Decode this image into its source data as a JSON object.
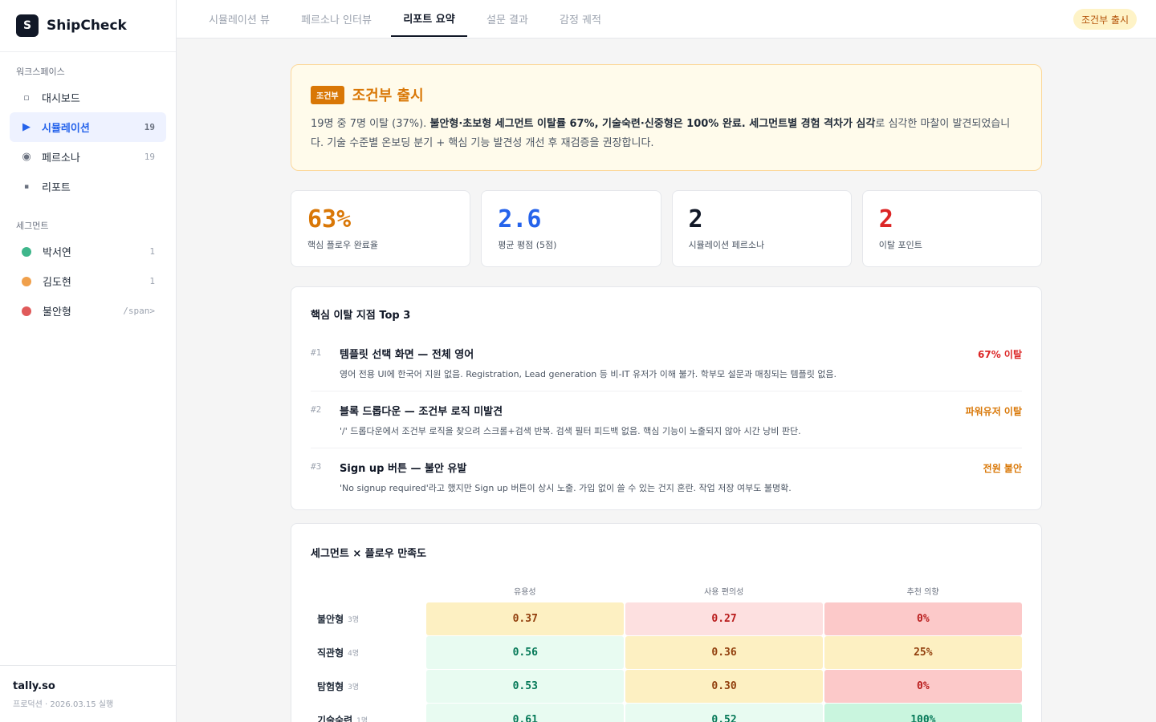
{
  "app": {
    "logo_letter": "S",
    "name": "ShipCheck"
  },
  "sidebar": {
    "workspace_label": "워크스페이스",
    "items": [
      {
        "label": "대시보드",
        "count": "",
        "icon": "square-icon"
      },
      {
        "label": "시뮬레이션",
        "count": "19",
        "icon": "play-icon"
      },
      {
        "label": "페르소나",
        "count": "19",
        "icon": "record-icon"
      },
      {
        "label": "리포트",
        "count": "",
        "icon": "small-square-icon"
      }
    ],
    "segment_label": "세그먼트",
    "segments": [
      {
        "label": "박서연",
        "count": "1",
        "color": "#3fb68b"
      },
      {
        "label": "김도현",
        "count": "1",
        "color": "#f0a04b"
      },
      {
        "label": "불안형",
        "count": "/span>",
        "color": "#e05a5a"
      }
    ],
    "footer": {
      "title": "tally.so",
      "sub": "프로덕션 · 2026.03.15 실행"
    }
  },
  "tabs": [
    "시뮬레이션 뷰",
    "페르소나 인터뷰",
    "리포트 요약",
    "설문 결과",
    "감정 궤적"
  ],
  "top_badge": "조건부 출시",
  "banner": {
    "chip": "조건부",
    "title": "조건부 출시",
    "text_pre": "19명 중 7명 이탈 (37%). ",
    "text_bold": "불안형·초보형 세그먼트 이탈률 67%, 기술숙련·신중형은 100% 완료. 세그먼트별 경험 격차가 심각",
    "text_post": "로 심각한 마찰이 발견되었습니다. 기술 수준별 온보딩 분기 + 핵심 기능 발견성 개선 후 재검증을 권장합니다."
  },
  "stats": [
    {
      "value": "63%",
      "label": "핵심 플로우 완료율",
      "color": "#d97706"
    },
    {
      "value": "2.6",
      "label": "평균 평점 (5점)",
      "color": "#2563eb"
    },
    {
      "value": "2",
      "label": "시뮬레이션 페르소나",
      "color": "#111827"
    },
    {
      "value": "2",
      "label": "이탈 포인트",
      "color": "#dc2626"
    }
  ],
  "drops": {
    "title": "핵심 이탈 지점 Top 3",
    "items": [
      {
        "rank": "#1",
        "title": "템플릿 선택 화면 — 전체 영어",
        "desc": "영어 전용 UI에 한국어 지원 없음. Registration, Lead generation 등 비-IT 유저가 이해 불가. 학부모 설문과 매칭되는 템플릿 없음.",
        "tag": "67% 이탈",
        "tag_color": "#dc2626"
      },
      {
        "rank": "#2",
        "title": "블록 드롭다운 — 조건부 로직 미발견",
        "desc": "'/' 드롭다운에서 조건부 로직을 찾으려 스크롤+검색 반복. 검색 필터 피드백 없음. 핵심 기능이 노출되지 않아 시간 낭비 판단.",
        "tag": "파워유저 이탈",
        "tag_color": "#d97706"
      },
      {
        "rank": "#3",
        "title": "Sign up 버튼 — 불안 유발",
        "desc": "'No signup required'라고 했지만 Sign up 버튼이 상시 노출. 가입 없이 쓸 수 있는 건지 혼란. 작업 저장 여부도 불명확.",
        "tag": "전원 불안",
        "tag_color": "#d97706"
      }
    ]
  },
  "matrix": {
    "title": "세그먼트 × 플로우 만족도",
    "columns": [
      "유용성",
      "사용 편의성",
      "추천 의향"
    ],
    "rows": [
      {
        "label": "불안형",
        "n": "3명",
        "cells": [
          {
            "v": "0.37",
            "c": "c-yellow"
          },
          {
            "v": "0.27",
            "c": "c-pink"
          },
          {
            "v": "0%",
            "c": "c-red"
          }
        ]
      },
      {
        "label": "직관형",
        "n": "4명",
        "cells": [
          {
            "v": "0.56",
            "c": "c-mint"
          },
          {
            "v": "0.36",
            "c": "c-yellow"
          },
          {
            "v": "25%",
            "c": "c-yellow"
          }
        ]
      },
      {
        "label": "탐험형",
        "n": "3명",
        "cells": [
          {
            "v": "0.53",
            "c": "c-mint"
          },
          {
            "v": "0.30",
            "c": "c-yellow"
          },
          {
            "v": "0%",
            "c": "c-red"
          }
        ]
      },
      {
        "label": "기술숙련",
        "n": "1명",
        "cells": [
          {
            "v": "0.61",
            "c": "c-mint"
          },
          {
            "v": "0.52",
            "c": "c-mint"
          },
          {
            "v": "100%",
            "c": "c-green"
          }
        ]
      }
    ]
  }
}
